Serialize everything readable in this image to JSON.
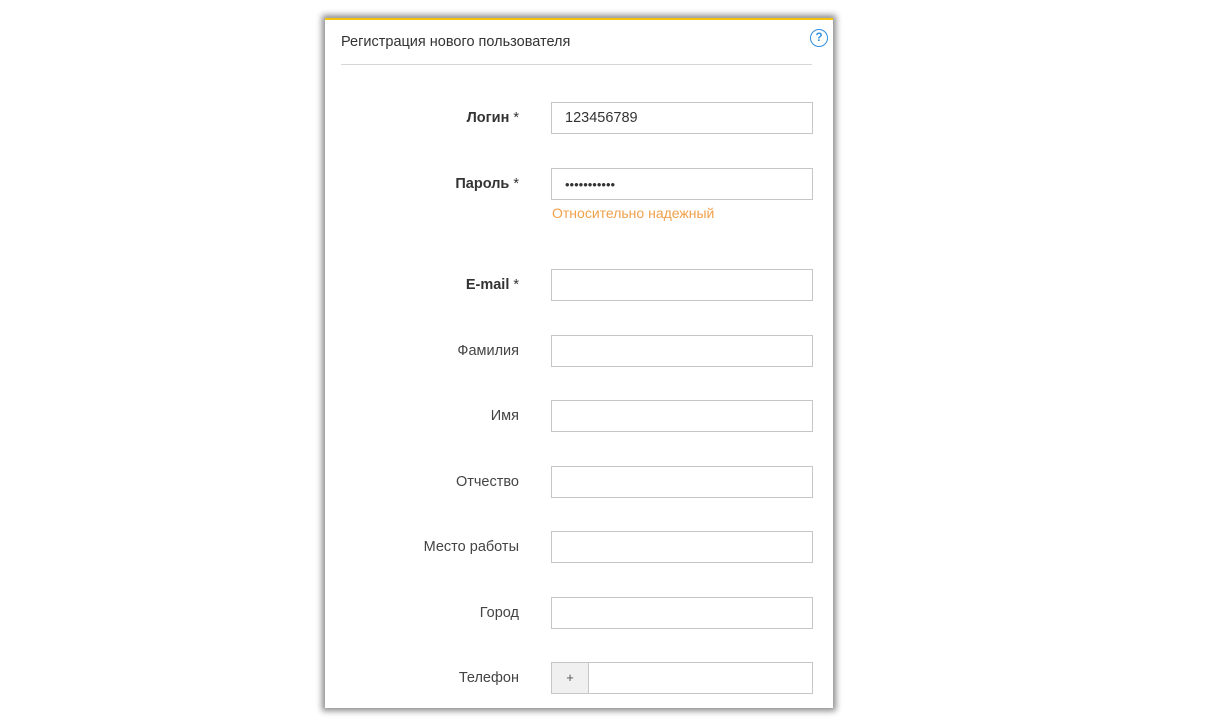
{
  "form": {
    "title": "Регистрация нового пользователя",
    "help_icon": "question-circle-icon",
    "help_symbol": "?",
    "accent_color": "#f2c40f",
    "required_mark": "*",
    "login": {
      "label": "Логин",
      "value": "123456789"
    },
    "password": {
      "label": "Пароль",
      "value": "•••••••••••",
      "strength": "Относительно надежный",
      "strength_color": "#f0a04b"
    },
    "email": {
      "label": "E-mail",
      "value": ""
    },
    "surname": {
      "label": "Фамилия",
      "value": ""
    },
    "name": {
      "label": "Имя",
      "value": ""
    },
    "patronymic": {
      "label": "Отчество",
      "value": ""
    },
    "workplace": {
      "label": "Место работы",
      "value": ""
    },
    "city": {
      "label": "Город",
      "value": ""
    },
    "phone": {
      "label": "Телефон",
      "prefix": "+",
      "value": ""
    }
  }
}
